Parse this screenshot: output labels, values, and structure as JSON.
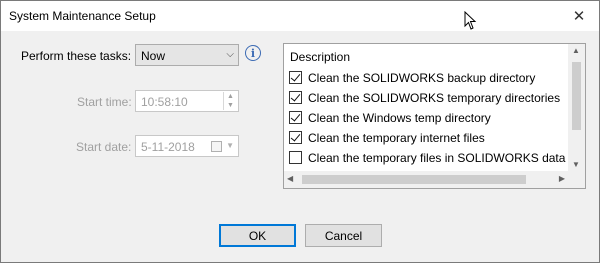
{
  "window": {
    "title": "System Maintenance Setup",
    "close_icon": "close-icon"
  },
  "tasks": {
    "label": "Perform these tasks:",
    "selected": "Now",
    "info_icon": "info-icon",
    "info_glyph": "i"
  },
  "start_time": {
    "label": "Start time:",
    "value": "10:58:10"
  },
  "start_date": {
    "label": "Start date:",
    "value": "5-11-2018"
  },
  "task_list": {
    "header": "Description",
    "items": [
      {
        "label": "Clean the SOLIDWORKS backup directory",
        "checked": true
      },
      {
        "label": "Clean the SOLIDWORKS temporary directories",
        "checked": true
      },
      {
        "label": "Clean the Windows temp directory",
        "checked": true
      },
      {
        "label": "Clean the temporary internet files",
        "checked": true
      },
      {
        "label": "Clean the temporary files in SOLIDWORKS data fo",
        "checked": false
      }
    ]
  },
  "buttons": {
    "ok": "OK",
    "cancel": "Cancel"
  }
}
